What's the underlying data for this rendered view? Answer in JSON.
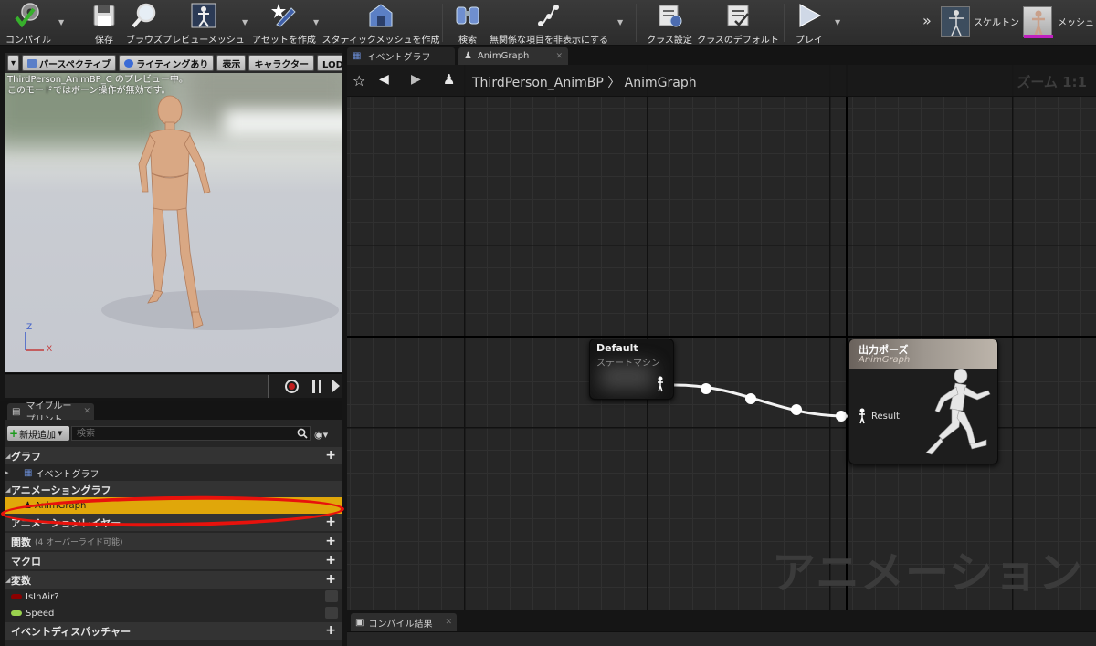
{
  "toolbar": {
    "buttons": [
      {
        "label": "コンパイル",
        "icon": "compile-check-icon"
      },
      {
        "label": "保存",
        "icon": "save-disk-icon"
      },
      {
        "label": "ブラウズ",
        "icon": "browse-magnifier-icon"
      },
      {
        "label": "プレビューメッシュ",
        "icon": "preview-mesh-icon"
      },
      {
        "label": "アセットを作成",
        "icon": "create-asset-icon"
      },
      {
        "label": "スタティックメッシュを作成",
        "icon": "static-mesh-icon"
      },
      {
        "label": "検索",
        "icon": "binoculars-icon"
      },
      {
        "label": "無関係な項目を非表示にする",
        "icon": "hide-unrelated-icon"
      },
      {
        "label": "クラス設定",
        "icon": "class-settings-icon"
      },
      {
        "label": "クラスのデフォルト",
        "icon": "class-defaults-icon"
      },
      {
        "label": "プレイ",
        "icon": "play-icon"
      }
    ],
    "mode_skeleton": "スケルトン",
    "mode_mesh": "メッシュ"
  },
  "viewport": {
    "chips": [
      "パースペクティブ",
      "ライティングあり",
      "表示",
      "キャラクター",
      "LOD オー"
    ],
    "note_line1": "ThirdPerson_AnimBP_C のプレビュー中。",
    "note_line2": "このモードではボーン操作が無効です。",
    "axis_z": "Z",
    "axis_x": "X"
  },
  "my_blueprint": {
    "tab_label": "マイブループリント",
    "add_new": "新規追加",
    "search_placeholder": "検索",
    "categories": {
      "graph": "グラフ",
      "anim_graph": "アニメーショングラフ",
      "anim_layer": "アニメーションレイヤー",
      "functions": "関数",
      "functions_count": "(4 オーバーライド可能)",
      "macros": "マクロ",
      "variables": "変数",
      "dispatchers": "イベントディスパッチャー"
    },
    "items": {
      "event_graph": "イベントグラフ",
      "anim_graph": "AnimGraph",
      "var_is_in_air": "IsInAir?",
      "var_speed": "Speed"
    }
  },
  "tabs": {
    "event_graph": "イベントグラフ",
    "anim_graph": "AnimGraph"
  },
  "graph": {
    "breadcrumb": "ThirdPerson_AnimBP 〉 AnimGraph",
    "zoom": "ズーム 1:1",
    "watermark": "アニメーション",
    "node_default_title": "Default",
    "node_default_sub": "ステートマシン",
    "node_output_title": "出力ポーズ",
    "node_output_sub": "AnimGraph",
    "result_pin": "Result"
  },
  "compile_results_tab": "コンパイル結果",
  "colors": {
    "selection": "#e0a70a",
    "highlight_oval": "#e8120c",
    "bool_var": "#8b0000",
    "float_var": "#9ad24e"
  }
}
